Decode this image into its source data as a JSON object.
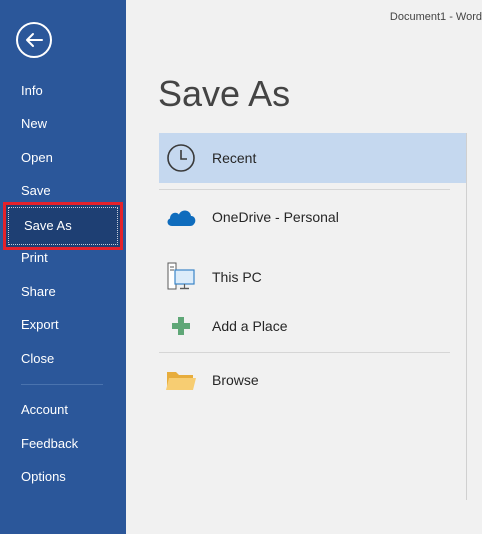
{
  "window": {
    "doc_title": "Document1 - Word"
  },
  "sidebar": {
    "items": [
      {
        "label": "Info"
      },
      {
        "label": "New"
      },
      {
        "label": "Open"
      },
      {
        "label": "Save"
      },
      {
        "label": "Save As"
      },
      {
        "label": "Print"
      },
      {
        "label": "Share"
      },
      {
        "label": "Export"
      },
      {
        "label": "Close"
      },
      {
        "label": "Account"
      },
      {
        "label": "Feedback"
      },
      {
        "label": "Options"
      }
    ]
  },
  "main": {
    "title": "Save As",
    "locations": [
      {
        "label": "Recent",
        "icon": "clock-icon"
      },
      {
        "label": "OneDrive - Personal",
        "icon": "onedrive-cloud-icon"
      },
      {
        "label": "This PC",
        "icon": "computer-icon"
      },
      {
        "label": "Add a Place",
        "icon": "plus-icon"
      },
      {
        "label": "Browse",
        "icon": "folder-icon"
      }
    ]
  },
  "colors": {
    "sidebar": "#2b579a",
    "sidebar_selected": "#1e3f73",
    "highlight_border": "#e5222b",
    "recent_highlight": "#c5d8ef",
    "onedrive": "#0f6cbd",
    "add_place": "#5fa777",
    "folder": "#f3c25f"
  }
}
